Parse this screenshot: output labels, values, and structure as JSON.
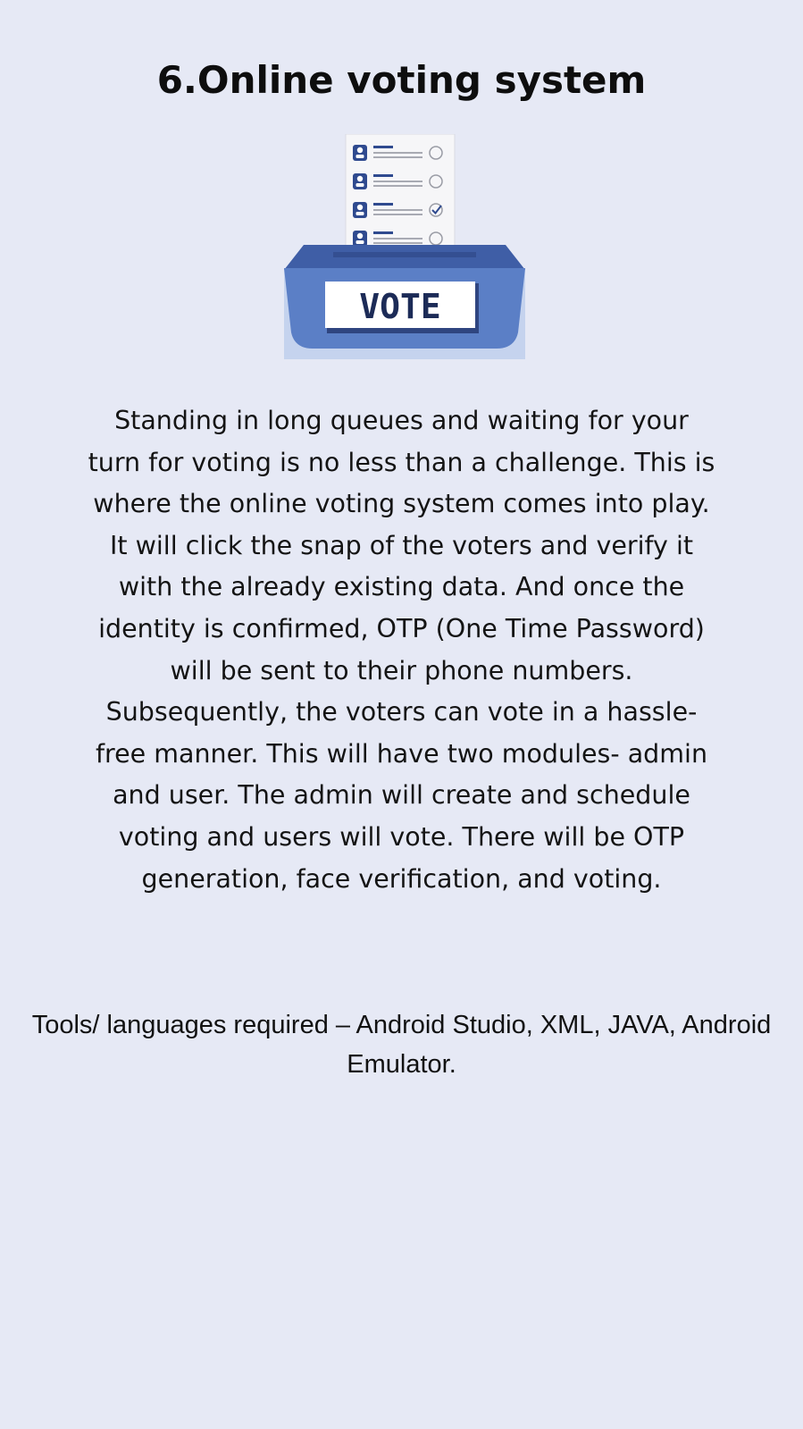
{
  "heading": {
    "title": "6.Online voting system"
  },
  "illustration": {
    "box_label": "VOTE",
    "icon": "ballot-box-icon",
    "ballot_rows": 4,
    "checked_row": 3,
    "colors": {
      "box_front": "#5b7fc6",
      "box_top": "#3f5ea6",
      "box_back": "#c5d3ee",
      "label_text": "#1c2b57",
      "person_icon": "#2f4a8f"
    }
  },
  "body": {
    "description": "Standing in long queues and waiting for your turn for voting is no less than a challenge. This is where the online voting system comes into play. It will click the snap of the voters and verify it with the already existing data. And once the identity is confirmed, OTP (One Time Password) will be sent to their phone numbers. Subsequently, the voters can vote in a hassle-free manner. This will have two modules- admin and user. The admin will create and schedule voting and users will vote. There will be OTP generation, face verification, and voting.",
    "tools": "Tools/ languages required – Android Studio, XML, JAVA, Android Emulator."
  }
}
